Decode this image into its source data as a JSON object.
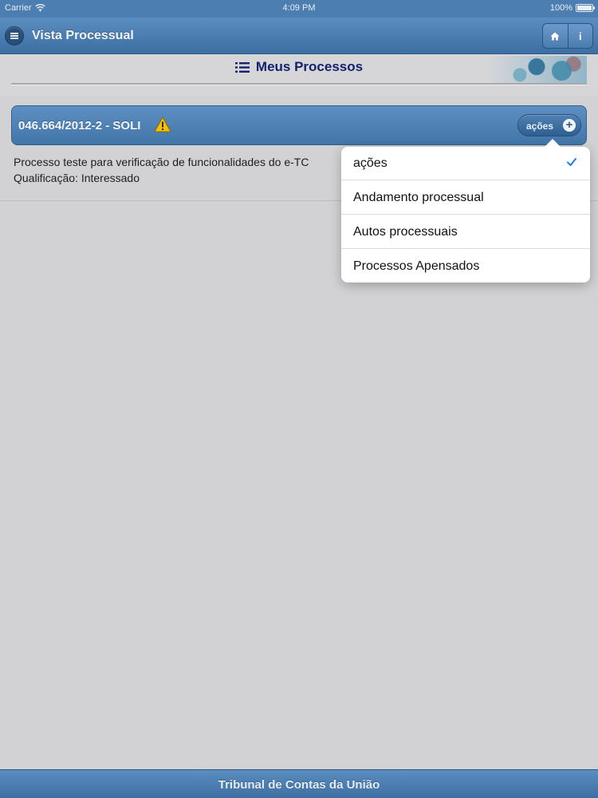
{
  "status_bar": {
    "carrier": "Carrier",
    "time": "4:09 PM",
    "battery": "100%",
    "icons": {
      "wifi": "wifi-icon",
      "battery": "battery-icon"
    }
  },
  "header": {
    "title": "Vista Processual",
    "menu_icon": "menu-icon",
    "home_icon": "home-icon",
    "info_label": "i"
  },
  "section": {
    "title": "Meus Processos",
    "icon": "list-icon"
  },
  "process": {
    "id_label": "046.664/2012-2 - SOLI",
    "warning_icon": "warning-icon",
    "actions_label": "ações",
    "description": "Processo teste para verificação de funcionalidades do e-TC",
    "qualification": "Qualificação: Interessado"
  },
  "actions_menu": {
    "items": [
      {
        "label": "ações",
        "selected": true
      },
      {
        "label": "Andamento processual",
        "selected": false
      },
      {
        "label": "Autos processuais",
        "selected": false
      },
      {
        "label": "Processos Apensados",
        "selected": false
      }
    ]
  },
  "footer": {
    "text": "Tribunal de Contas da União"
  },
  "colors": {
    "bar_blue": "#4d7eb1",
    "title_navy": "#14226b",
    "check_blue": "#1a7ee6",
    "warning_yellow": "#f2c200"
  }
}
